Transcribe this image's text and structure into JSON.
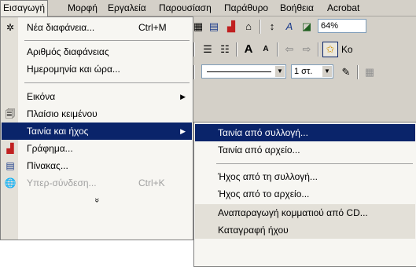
{
  "menubar": {
    "items": [
      "Εισαγωγή",
      "Μορφή",
      "Εργαλεία",
      "Παρουσίαση",
      "Παράθυρο",
      "Βοήθεια",
      "Acrobat"
    ]
  },
  "toolbar": {
    "zoom_value": "64%",
    "font_partial": "Κο",
    "line_spacing_value": "1 στ."
  },
  "insert_menu": {
    "items": [
      {
        "label": "Νέα διαφάνεια...",
        "shortcut": "Ctrl+M",
        "icon": "new-slide-icon"
      },
      {
        "label": "Αριθμός διαφάνειας"
      },
      {
        "label": "Ημερομηνία και ώρα..."
      },
      {
        "label": "Εικόνα",
        "has_submenu": true
      },
      {
        "label": "Πλαίσιο κειμένου",
        "icon": "text-box-icon"
      },
      {
        "label": "Ταινία και ήχος",
        "has_submenu": true,
        "highlighted": true
      },
      {
        "label": "Γράφημα...",
        "icon": "chart-icon"
      },
      {
        "label": "Πίνακας...",
        "icon": "table-icon"
      },
      {
        "label": "Υπερ-σύνδεση...",
        "shortcut": "Ctrl+K",
        "disabled": true,
        "icon": "hyperlink-icon"
      }
    ],
    "expand_glyph": "»"
  },
  "movies_sounds_submenu": {
    "items": [
      "Ταινία από συλλογή...",
      "Ταινία από αρχείο...",
      "Ήχος από τη συλλογή...",
      "Ήχος από το αρχείο...",
      "Αναπαραγωγή κομματιού από CD...",
      "Καταγραφή ήχου"
    ]
  },
  "colors": {
    "highlight": "#0a246a",
    "menu_bg": "#f7f6f2",
    "chrome": "#d4d0c8"
  }
}
